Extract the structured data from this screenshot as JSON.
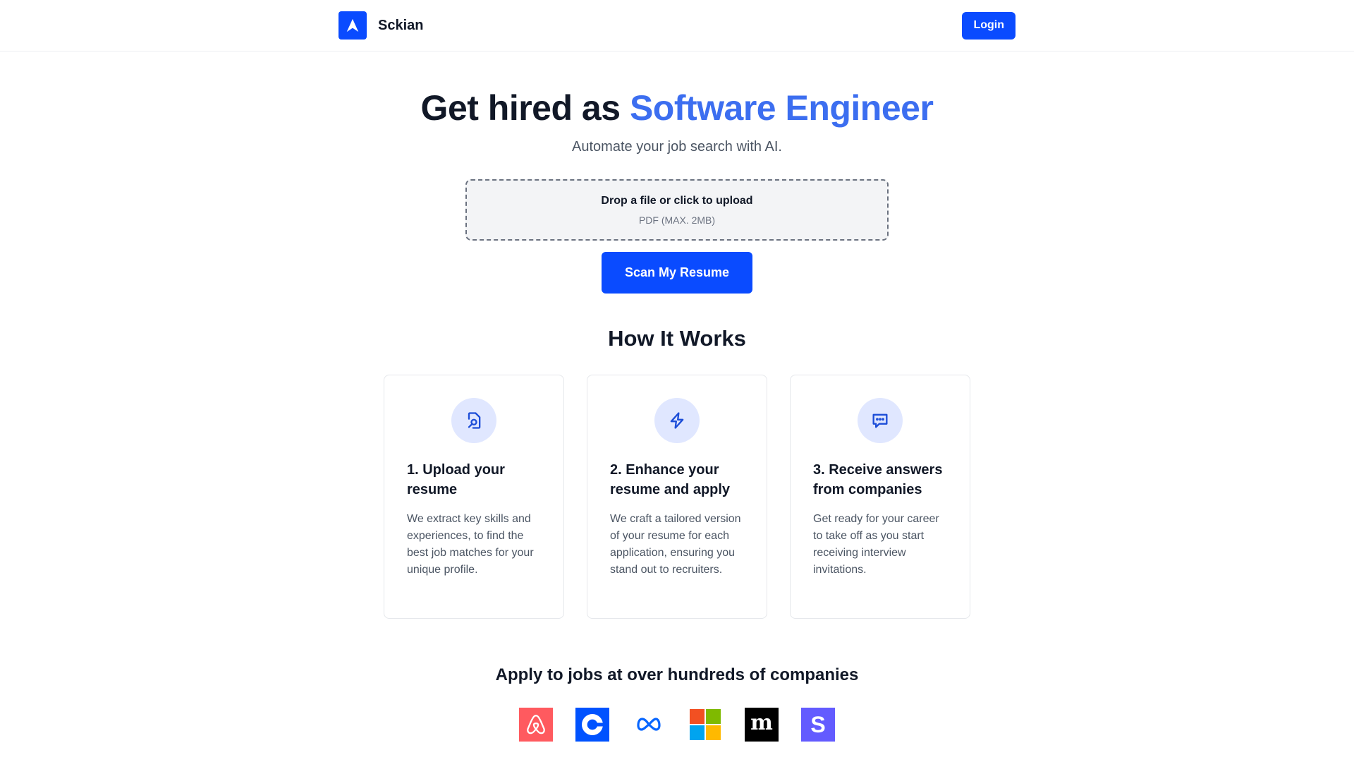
{
  "nav": {
    "brand": "Sckian",
    "login_label": "Login",
    "logo_icon": "navigation-arrow-icon"
  },
  "hero": {
    "title_prefix": "Get hired as ",
    "title_role": "Software Engineer",
    "subtitle": "Automate your job search with AI."
  },
  "upload": {
    "title": "Drop a file or click to upload",
    "hint": "PDF (MAX. 2MB)"
  },
  "scan_button": "Scan My Resume",
  "how_it_works": {
    "title": "How It Works",
    "steps": [
      {
        "icon": "file-search-icon",
        "title": "1. Upload your resume",
        "description": "We extract key skills and experiences, to find the best job matches for your unique profile."
      },
      {
        "icon": "lightning-icon",
        "title": "2. Enhance your resume and apply",
        "description": "We craft a tailored version of your resume for each application, ensuring you stand out to recruiters."
      },
      {
        "icon": "chat-bubble-icon",
        "title": "3. Receive answers from companies",
        "description": "Get ready for your career to take off as you start receiving interview invitations."
      }
    ]
  },
  "companies": {
    "title": "Apply to jobs at over hundreds of companies",
    "logos": [
      "Airbnb",
      "Coinbase",
      "Meta",
      "Microsoft",
      "Medium",
      "Stripe"
    ]
  },
  "colors": {
    "primary": "#0a4bff",
    "accent_text": "#3c6ef0",
    "icon_bg": "#e0e7ff",
    "icon_stroke": "#1d4ed8"
  }
}
